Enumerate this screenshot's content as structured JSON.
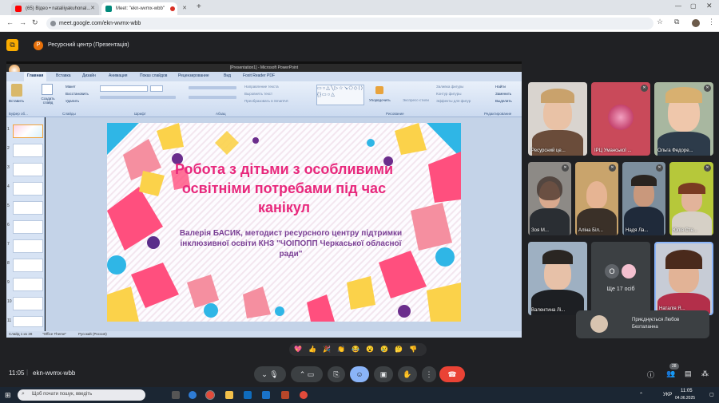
{
  "browser": {
    "tabs": [
      {
        "label": "(65) Відео • nataliiyakuhonal...",
        "active": false,
        "favicon_color": "#ff0000"
      },
      {
        "label": "Meet: \"ekn-wvmx-wbb\"",
        "active": true,
        "favicon_color": "#00897b"
      },
      {
        "label": "",
        "active": false,
        "favicon_color": "#d93025"
      }
    ],
    "new_tab": "+",
    "url": "meet.google.com/ekn-wvmx-wbb"
  },
  "meet": {
    "presenter_label": "Ресурсний центр (Презентація)",
    "presenter_initial": "Р",
    "meeting_time": "11:05",
    "meeting_code": "ekn-wvmx-wbb",
    "participant_count": "28",
    "others_count": "Ще 17 осіб",
    "others_initial": "О",
    "join_toast": "Приєднується Любов Безталанна",
    "reactions": [
      "💖",
      "👍",
      "🎉",
      "👏",
      "😂",
      "😮",
      "😢",
      "🤔",
      "👎"
    ]
  },
  "participants": [
    {
      "name": "Ресурсний це...",
      "skin": "#e9c2a6",
      "bg": "#d9d4cf"
    },
    {
      "name": "ІРЦ Уманської ...",
      "skin": "",
      "bg": "#c94a5a"
    },
    {
      "name": "Ольга Федоре...",
      "skin": "#efc7ab",
      "bg": "#a8b7a0"
    },
    {
      "name": "Зоя М...",
      "skin": "#d9a98e",
      "bg": "#8d8a86"
    },
    {
      "name": "Аліна Біл...",
      "skin": "#e6b493",
      "bg": "#c9a46c"
    },
    {
      "name": "Надя Ла...",
      "skin": "#c9987c",
      "bg": "#7d8f9e"
    },
    {
      "name": "Юлія Сте...",
      "skin": "#e2b39a",
      "bg": "#b6c83a"
    },
    {
      "name": "Валентина Лі...",
      "skin": "#e7c1a8",
      "bg": "#9eb0c2"
    },
    {
      "name": "Наталія Я...",
      "skin": "#e2b396",
      "bg": "#c7ccd6"
    }
  ],
  "powerpoint": {
    "title_bar": "[Presentation1] - Microsoft PowerPoint",
    "tabs": [
      "Главная",
      "Вставка",
      "Дизайн",
      "Анимация",
      "Показ слайдов",
      "Рецензирование",
      "Вид",
      "Foxit Reader PDF"
    ],
    "groups": [
      "Буфер об...",
      "Слайды",
      "Шрифт",
      "Абзац",
      "Рисование",
      "Редактирование"
    ],
    "buttons": [
      "Вставить",
      "Создать слайд",
      "Макет",
      "Восстановить",
      "Удалить",
      "Упорядочить",
      "Экспресс-стили",
      "Заливка фигуры",
      "Контур фигуры",
      "Эффекты для фигур",
      "Найти",
      "Заменить",
      "Выделить",
      "Направление текста",
      "Выровнять текст",
      "Преобразовать в SmartArt"
    ],
    "status": [
      "Слайд 1 из 28",
      "\"Office Theme\"",
      "Русский (Россия)"
    ],
    "thumb_numbers": [
      "1",
      "2",
      "3",
      "4",
      "5",
      "6",
      "7",
      "8",
      "9",
      "10",
      "11"
    ]
  },
  "slide": {
    "title": "Робота з дітьми з особливими освітніми потребами під час канікул",
    "subtitle": "Валерія БАСИК, методист ресурсного центру підтримки інклюзивної освіти КНЗ \"ЧОІПОПП Черкаської обласної ради\"",
    "colors": {
      "title": "#e8287c",
      "subtitle": "#7a3f95"
    }
  },
  "taskbar": {
    "search_placeholder": "Щоб почати пошук, введіть",
    "lang": "УКР",
    "time": "11:05",
    "date": "04.06.2025"
  }
}
